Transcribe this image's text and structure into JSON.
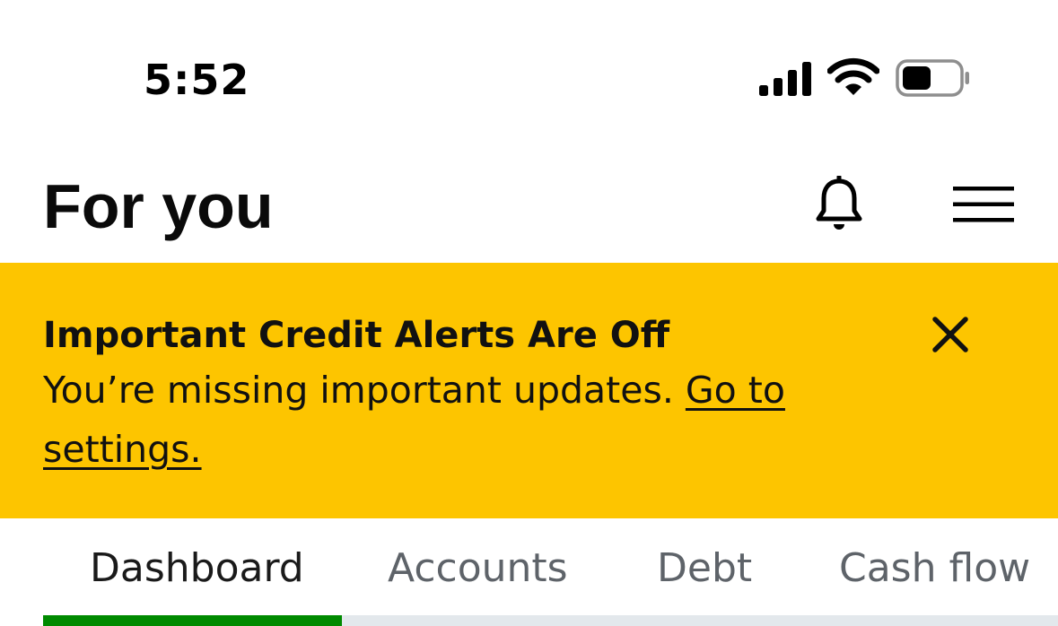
{
  "status_bar": {
    "time": "5:52",
    "icons": [
      "signal-icon",
      "wifi-icon",
      "battery-icon"
    ]
  },
  "header": {
    "title": "For you",
    "icons": [
      "bell-icon",
      "hamburger-menu-icon"
    ]
  },
  "alert": {
    "title": "Important Credit Alerts Are Off",
    "message": "You’re missing important updates. ",
    "link_label": "Go to settings.",
    "background_color": "#fdc500",
    "close_icon": "close-icon"
  },
  "tabs": {
    "items": [
      {
        "label": "Dashboard",
        "selected": true
      },
      {
        "label": "Accounts",
        "selected": false
      },
      {
        "label": "Debt",
        "selected": false
      },
      {
        "label": "Cash flow",
        "selected": false
      }
    ],
    "indicator_color": "#008a00"
  }
}
